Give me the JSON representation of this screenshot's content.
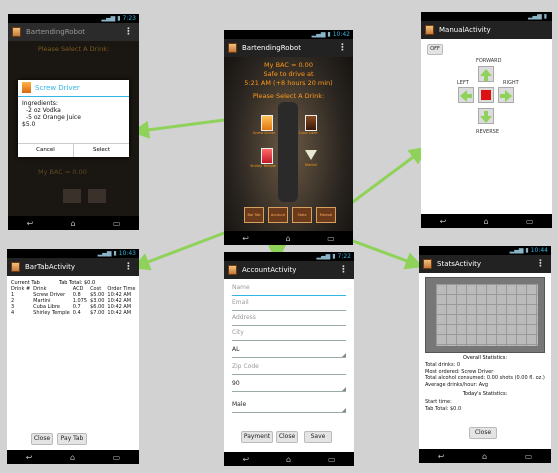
{
  "screens": {
    "main": {
      "time": "10:42",
      "title": "BartendingRobot",
      "bac": "My BAC = 0.00",
      "safe": "Safe to drive at",
      "safe_time": "5:21 AM (+8 hours 20 min)",
      "prompt": "Please Select A Drink:",
      "drinks": [
        "Screw Driver",
        "Cuba Libre",
        "Shirley Temple",
        "Martini"
      ],
      "bottom_buttons": [
        "Bar Tab",
        "Account",
        "Stats",
        "Manual"
      ]
    },
    "dialog": {
      "time": "7:23",
      "title": "BartendingRobot",
      "prompt": "Please Select A Drink:",
      "dialog_title": "Screw Driver",
      "body_heading": "Ingredients:",
      "ingredients": [
        "-2 oz Vodka",
        "-5 oz Orange Juice"
      ],
      "price": "$5.0",
      "cancel": "Cancel",
      "select": "Select",
      "bac_behind": "My BAC = 0.00"
    },
    "manual": {
      "title": "ManualActivity",
      "toggle": "OFF",
      "forward": "FORWARD",
      "left": "LEFT",
      "right": "RIGHT",
      "reverse": "REVERSE"
    },
    "bartab": {
      "time": "10:43",
      "title": "BarTabActivity",
      "current_tab": "Current Tab",
      "tab_total": "Tab Total: $0.0",
      "headers": [
        "Drink #",
        "Drink",
        "ACD",
        "Cost",
        "Order Time"
      ],
      "rows": [
        [
          "1",
          "Screw Driver",
          "0.8",
          "$5.00",
          "10:42 AM"
        ],
        [
          "2",
          "Martini",
          "1.075",
          "$3.00",
          "10:42 AM"
        ],
        [
          "3",
          "Cuba Libre",
          "0.7",
          "$6.00",
          "10:42 AM"
        ],
        [
          "4",
          "Shirley Temple",
          "0.4",
          "$7.00",
          "10:42 AM"
        ]
      ],
      "close": "Close",
      "pay": "Pay Tab"
    },
    "account": {
      "time": "7:22",
      "title": "AccountActivity",
      "name": "Name",
      "email": "Email",
      "address": "Address",
      "city": "City",
      "state": "AL",
      "zip": "Zip Code",
      "weight": "90",
      "gender": "Male",
      "payment": "Payment",
      "close": "Close",
      "save": "Save"
    },
    "stats": {
      "time": "10:44",
      "title": "StatsActivity",
      "overall": "Overall Statistics:",
      "total_drinks": "Total drinks: 0",
      "most_ordered": "Most ordered: Screw Driver",
      "alcohol": "Total alcohol consumed: 0.00 shots (0.00 fl. oz.)",
      "avg": "Average drinks/hour: Avg",
      "today": "Today's Statistics:",
      "start": "Start time:",
      "tab": "Tab Total: $0.0",
      "close": "Close"
    }
  },
  "colors": {
    "accent": "#33b5e5",
    "orange": "#ff9a1a",
    "arrow_green": "#8fd25a",
    "stop_red": "#d11"
  }
}
